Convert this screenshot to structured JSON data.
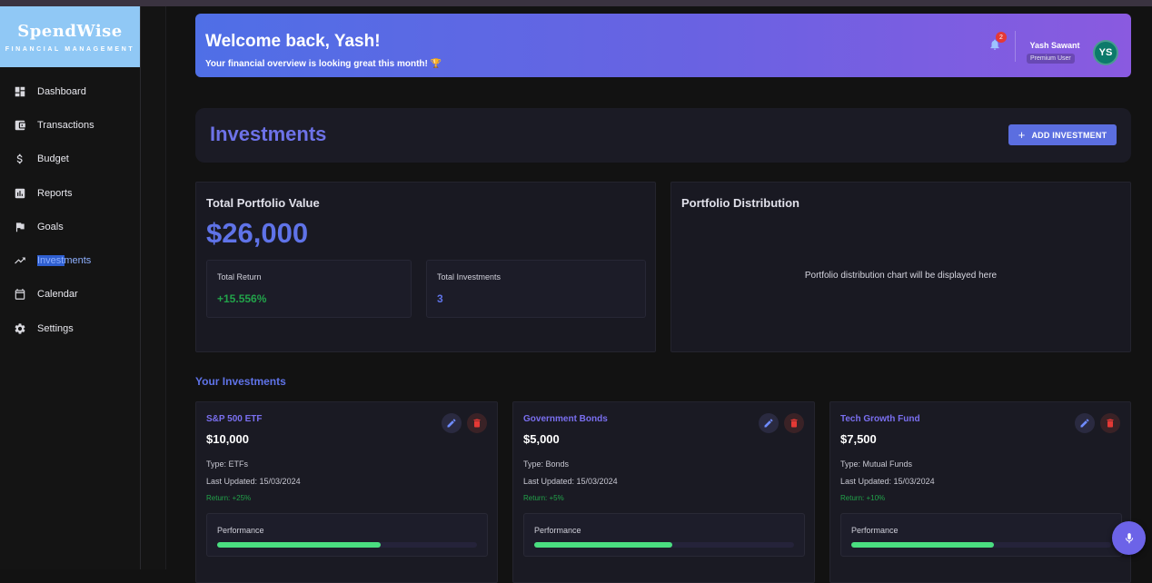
{
  "brand": {
    "name": "SpendWise",
    "subtitle": "FINANCIAL MANAGEMENT"
  },
  "sidebar": {
    "items": [
      {
        "label": "Dashboard",
        "icon": "dashboard-icon"
      },
      {
        "label": "Transactions",
        "icon": "wallet-icon"
      },
      {
        "label": "Budget",
        "icon": "dollar-icon"
      },
      {
        "label": "Reports",
        "icon": "bar-chart-icon"
      },
      {
        "label": "Goals",
        "icon": "flag-icon"
      },
      {
        "label": "Investments",
        "icon": "trending-up-icon",
        "active": true
      },
      {
        "label": "Calendar",
        "icon": "calendar-icon"
      },
      {
        "label": "Settings",
        "icon": "gear-icon"
      }
    ]
  },
  "header": {
    "welcome": "Welcome back, Yash!",
    "subtitle": "Your financial overview is looking great this month! 🏆",
    "notification_count": "2",
    "user_name": "Yash Sawant",
    "user_role": "Premium User",
    "avatar_initials": "YS"
  },
  "page": {
    "title": "Investments",
    "add_button": "ADD INVESTMENT"
  },
  "portfolio": {
    "title": "Total Portfolio Value",
    "value": "$26,000",
    "total_return_label": "Total Return",
    "total_return": "+15.556%",
    "total_investments_label": "Total Investments",
    "total_investments": "3"
  },
  "distribution": {
    "title": "Portfolio Distribution",
    "placeholder": "Portfolio distribution chart will be displayed here"
  },
  "investments_section": {
    "title": "Your Investments"
  },
  "investments": [
    {
      "name": "S&P 500 ETF",
      "amount": "$10,000",
      "type": "Type: ETFs",
      "updated": "Last Updated: 15/03/2024",
      "return": "Return: +25%",
      "performance_label": "Performance",
      "performance": 0.63
    },
    {
      "name": "Government Bonds",
      "amount": "$5,000",
      "type": "Type: Bonds",
      "updated": "Last Updated: 15/03/2024",
      "return": "Return: +5%",
      "performance_label": "Performance",
      "performance": 0.53
    },
    {
      "name": "Tech Growth Fund",
      "amount": "$7,500",
      "type": "Type: Mutual Funds",
      "updated": "Last Updated: 15/03/2024",
      "return": "Return: +10%",
      "performance_label": "Performance",
      "performance": 0.55
    }
  ],
  "colors": {
    "accent": "#5f73e8",
    "success": "#22a34a",
    "danger": "#e53935",
    "progress": "#4ade80"
  }
}
